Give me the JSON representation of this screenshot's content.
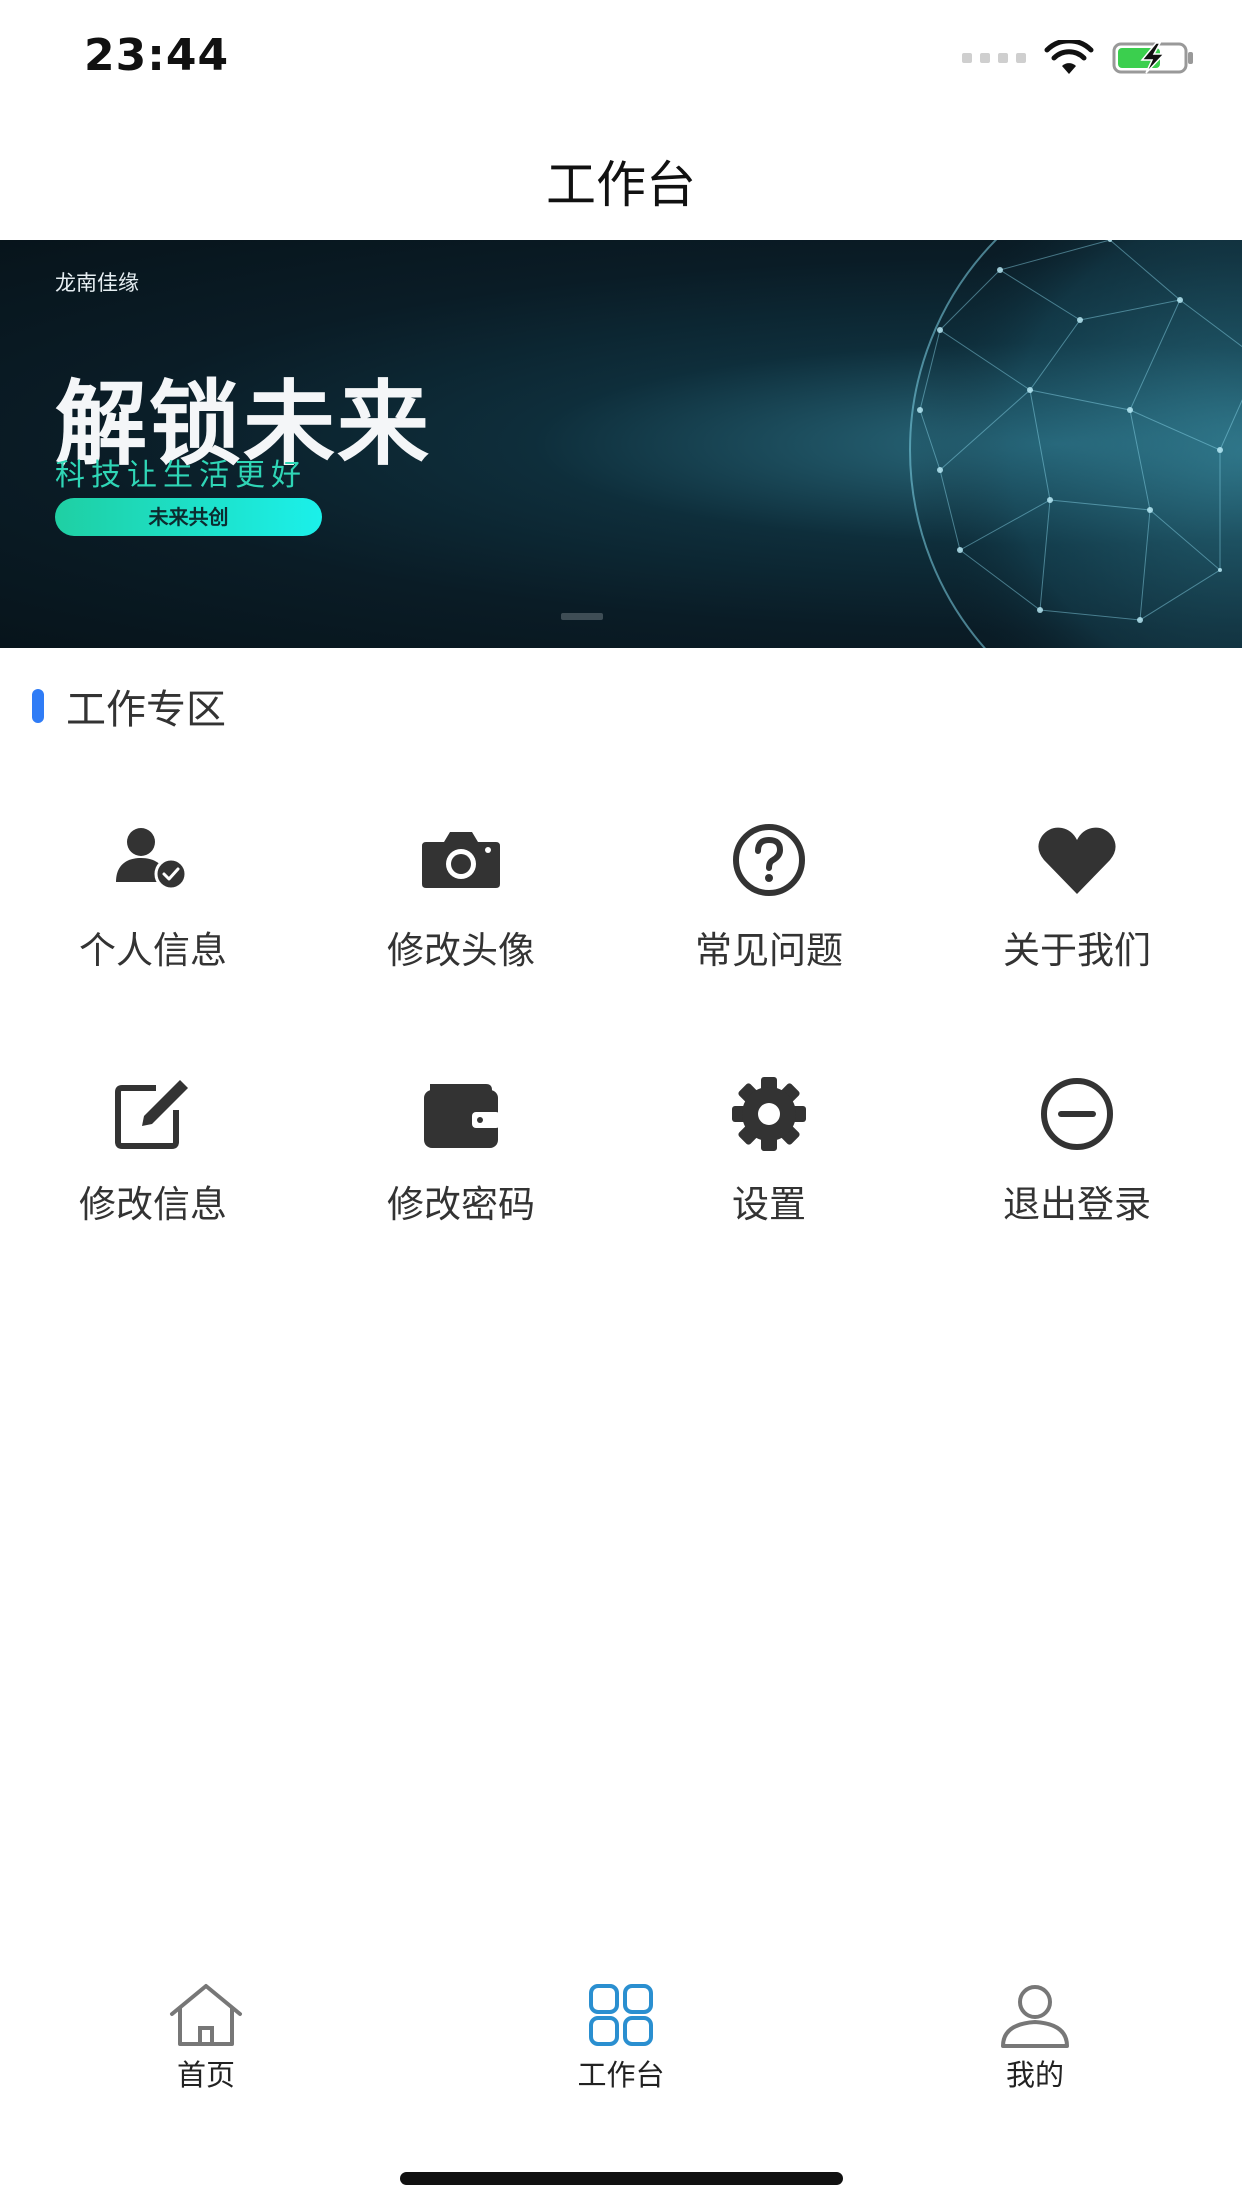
{
  "status_bar": {
    "time": "23:44",
    "icons": [
      "signal-dots-icon",
      "wifi-icon",
      "battery-charging-icon"
    ]
  },
  "header": {
    "title": "工作台"
  },
  "banner": {
    "brand": "龙南佳缘",
    "headline": "解锁未来",
    "subtitle": "科技让生活更好",
    "button": "未来共创"
  },
  "section": {
    "title": "工作专区",
    "accent_color": "#2f7cf6"
  },
  "grid": {
    "items": [
      {
        "label": "个人信息",
        "icon": "user-check-icon"
      },
      {
        "label": "修改头像",
        "icon": "camera-icon"
      },
      {
        "label": "常见问题",
        "icon": "question-circle-icon"
      },
      {
        "label": "关于我们",
        "icon": "heart-icon"
      },
      {
        "label": "修改信息",
        "icon": "edit-icon"
      },
      {
        "label": "修改密码",
        "icon": "wallet-icon"
      },
      {
        "label": "设置",
        "icon": "gear-icon"
      },
      {
        "label": "退出登录",
        "icon": "minus-circle-icon"
      }
    ]
  },
  "tab_bar": {
    "items": [
      {
        "label": "首页",
        "icon": "home-icon",
        "active": false
      },
      {
        "label": "工作台",
        "icon": "grid-icon",
        "active": true
      },
      {
        "label": "我的",
        "icon": "user-icon",
        "active": false
      }
    ],
    "active_color": "#2a8fd0"
  }
}
